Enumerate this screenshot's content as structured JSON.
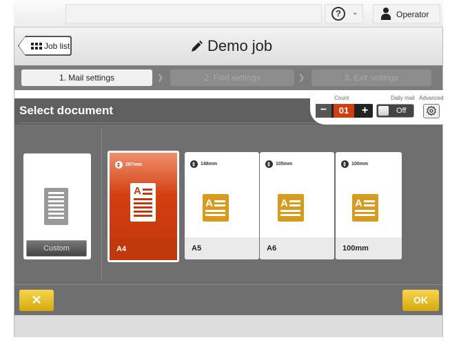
{
  "topbar": {
    "help_icon": "question-circle-icon",
    "operator_label": "Operator"
  },
  "header": {
    "job_list_label": "Job list",
    "job_title": "Demo job"
  },
  "steps": [
    {
      "label": "1. Mail settings",
      "active": true
    },
    {
      "label": "2. Fold settings",
      "active": false
    },
    {
      "label": "3. Exit settings",
      "active": false
    }
  ],
  "panel": {
    "title": "Select document",
    "count_label": "Count",
    "count_value": "01",
    "count_minus": "−",
    "count_plus": "+",
    "daily_mail_label": "Daily mail",
    "daily_mail_value": "Off",
    "advanced_label": "Advanced"
  },
  "documents": [
    {
      "name": "Custom",
      "size": "",
      "selected": false
    },
    {
      "name": "A4",
      "size": "297mm",
      "selected": true
    },
    {
      "name": "A5",
      "size": "148mm",
      "selected": false
    },
    {
      "name": "A6",
      "size": "105mm",
      "selected": false
    },
    {
      "name": "100mm",
      "size": "100mm",
      "selected": false
    }
  ],
  "actions": {
    "cancel_label": "✕",
    "ok_label": "OK"
  },
  "colors": {
    "accent_orange": "#d33f10",
    "gold": "#d99a20",
    "button_yellow": "#e8bf2c"
  }
}
